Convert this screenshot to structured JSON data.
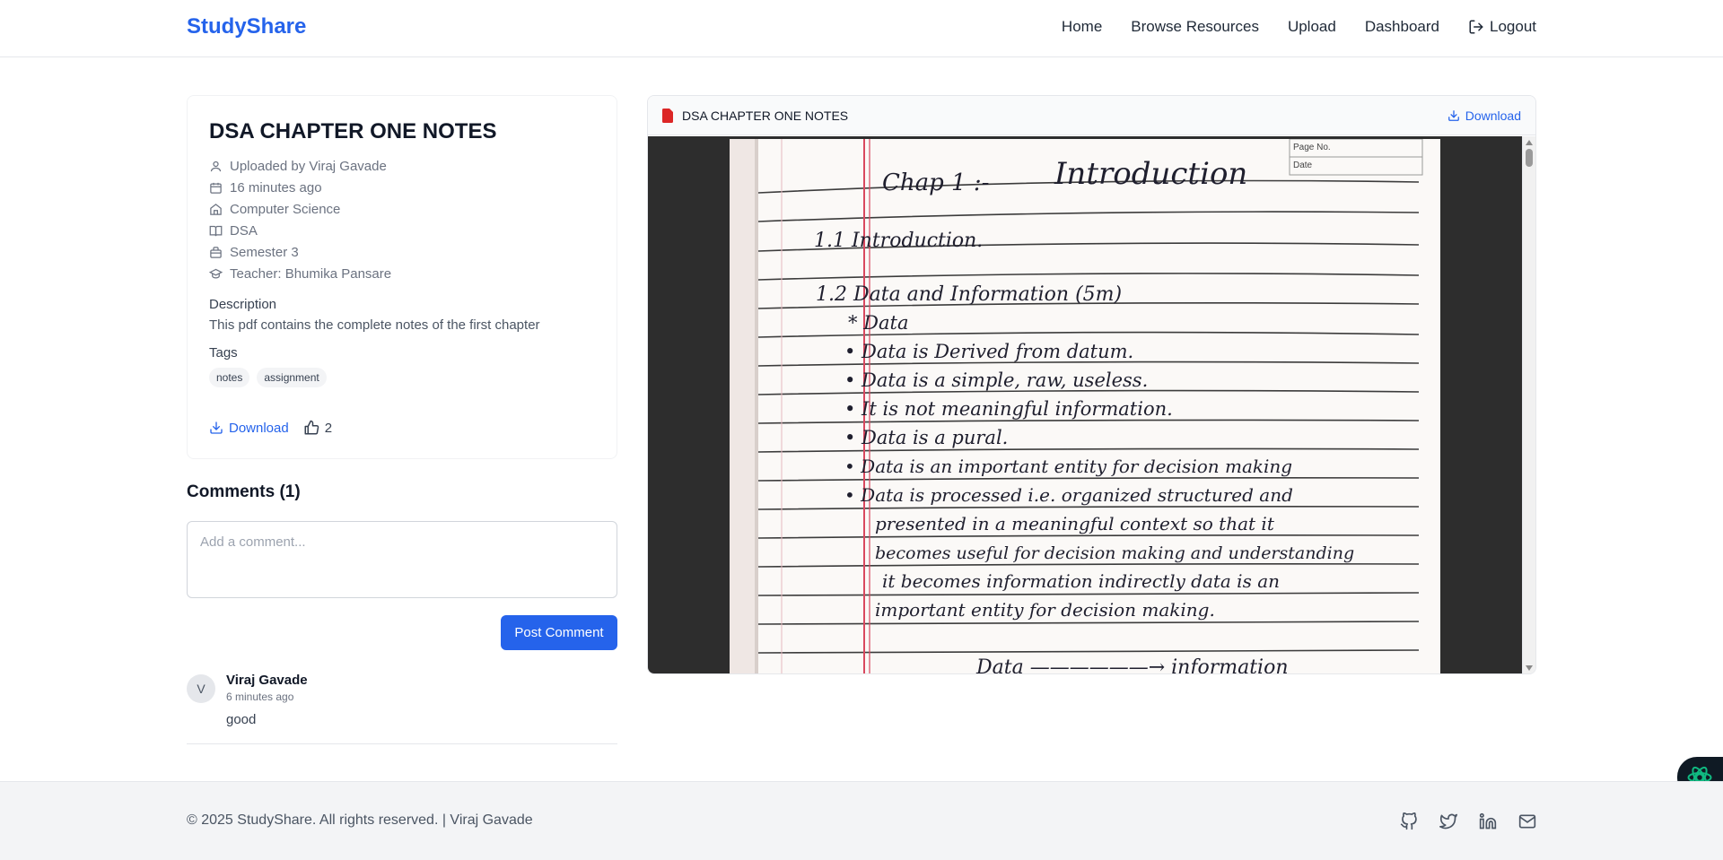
{
  "brand": "StudyShare",
  "nav": {
    "home": "Home",
    "browse": "Browse Resources",
    "upload": "Upload",
    "dashboard": "Dashboard",
    "logout": "Logout"
  },
  "resource": {
    "title": "DSA CHAPTER ONE NOTES",
    "uploaded_by": "Uploaded by Viraj Gavade",
    "uploaded_time": "16 minutes ago",
    "department": "Computer Science",
    "subject": "DSA",
    "semester": "Semester 3",
    "teacher": "Teacher: Bhumika Pansare",
    "description_label": "Description",
    "description": "This pdf contains the complete notes of the first chapter",
    "tags_label": "Tags",
    "tags": [
      "notes",
      "assignment"
    ],
    "download_label": "Download",
    "likes": "2"
  },
  "comments": {
    "title": "Comments (1)",
    "placeholder": "Add a comment...",
    "post_label": "Post Comment",
    "items": [
      {
        "initial": "V",
        "author": "Viraj Gavade",
        "time": "6 minutes ago",
        "text": "good"
      }
    ]
  },
  "viewer": {
    "file_name": "DSA CHAPTER ONE NOTES",
    "download_label": "Download",
    "page_header": {
      "page_no": "Page No.",
      "date": "Date"
    },
    "notes": {
      "heading_left": "Chap 1 :-",
      "heading_right": "Introduction",
      "lines": [
        "1.1  Introduction.",
        "1.2  Data  and  Information  (5m)",
        "* Data",
        "•  Data is Derived from datum.",
        "•  Data  is  a  simple,  raw,  useless.",
        "•  It  is  not  meaningful  information.",
        "•  Data  is  a  pural.",
        "•  Data  is  an  important  entity  for  decision  making",
        "•  Data  is  processed  i.e.  organized  structured  and",
        "presented  in  a  meaningful  context  so  that  it",
        "becomes  useful  for  decision  making  and  understanding",
        "it  becomes  information  indirectly  data  is  an",
        "important  entity  for  decision  making.",
        "Data  ——————→  information"
      ]
    }
  },
  "footer": {
    "copyright": "© 2025 StudyShare. All rights reserved. | Viraj Gavade"
  },
  "colors": {
    "brand": "#2563eb",
    "pdf_icon": "#dc2626",
    "notebook_margin": "#d9485f"
  },
  "icons": [
    "user-icon",
    "calendar-icon",
    "building-icon",
    "book-icon",
    "briefcase-icon",
    "graduation-cap-icon",
    "download-icon",
    "thumbs-up-icon",
    "logout-icon",
    "pdf-file-icon",
    "github-icon",
    "twitter-icon",
    "linkedin-icon",
    "mail-icon",
    "assistant-icon"
  ]
}
